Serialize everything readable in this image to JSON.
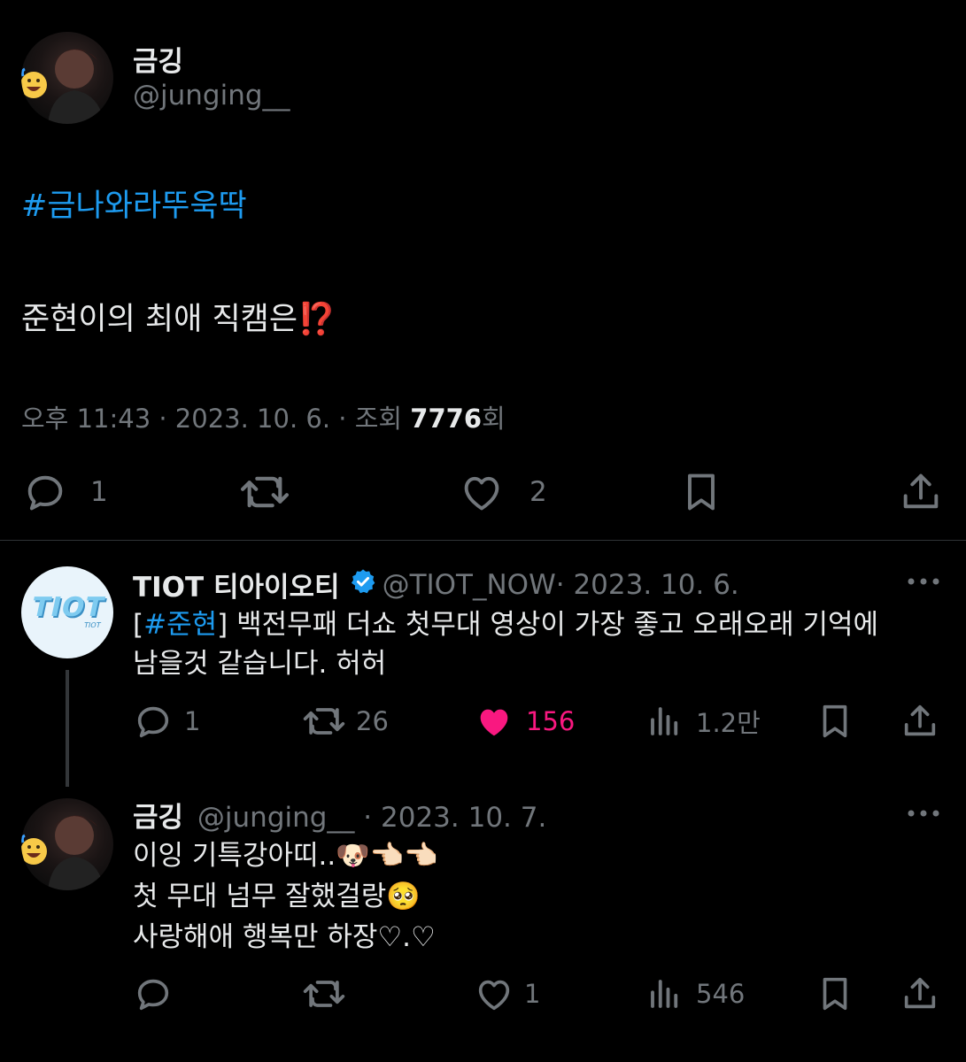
{
  "main_tweet": {
    "display_name": "금깅",
    "handle": "@junging__",
    "hashtag": "#금나와라뚜욱딱",
    "body": "준현이의 최애 직캠은⁉️",
    "time": "오후 11:43 · 2023. 10. 6. · 조회 ",
    "views": "7776",
    "views_suffix": "회",
    "actions": {
      "reply_count": "1",
      "like_count": "2"
    }
  },
  "reply_1": {
    "display_name": "TIOT 티아이오티",
    "handle": "@TIOT_NOW",
    "date": " · 2023. 10. 6.",
    "avatar_text": "TIOT",
    "avatar_subtext": "TIOT",
    "hashtag_open": "[",
    "hashtag": "#준현",
    "hashtag_close": "]",
    "text_line1": " 백전무패 더쇼 첫무대 영상이 가장 좋고 오래오래 기억에",
    "text_line2": "남을것 같습니다. 허허",
    "actions": {
      "reply_count": "1",
      "retweet_count": "26",
      "like_count": "156",
      "view_count": "1.2만"
    }
  },
  "reply_2": {
    "display_name": "금깅",
    "handle": "@junging__",
    "date": " · 2023. 10. 7.",
    "line1": "이잉 기특강아띠..🐶👈🏻👈🏻",
    "line2": "첫 무대 넘무 잘했걸랑🥺",
    "line3": "사랑해애 행복만 하장♡.♡",
    "actions": {
      "like_count": "1",
      "view_count": "546"
    }
  },
  "colors": {
    "background": "#000000",
    "text": "#e7e9ea",
    "muted": "#71767b",
    "link": "#1d9bf0",
    "like_active": "#f91880",
    "verified": "#1d9bf0"
  }
}
